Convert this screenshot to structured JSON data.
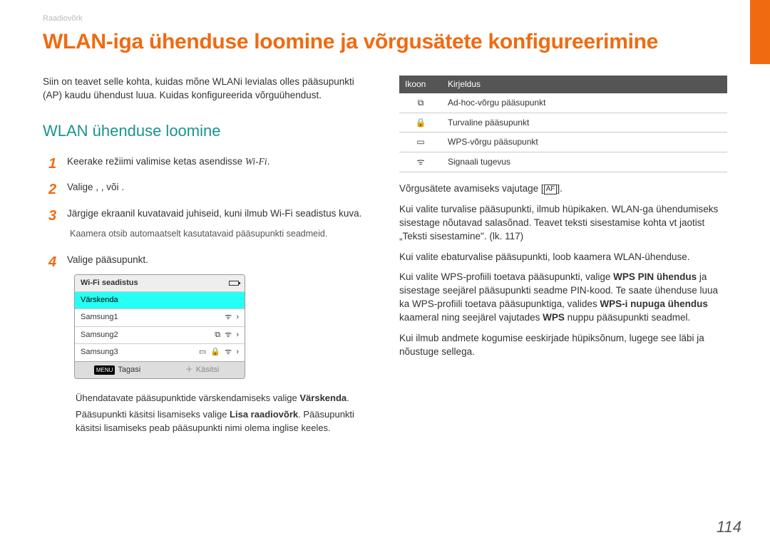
{
  "breadcrumb": "Raadiovõrk",
  "title": "WLAN-iga ühenduse loomine ja võrgusätete konfigureerimine",
  "intro": "Siin on teavet selle kohta, kuidas mõne WLANi levialas olles pääsupunkti (AP) kaudu ühendust luua. Kuidas konfigureerida võrguühendust.",
  "subheading": "WLAN ühenduse loomine",
  "steps": {
    "s1_a": "Keerake režiimi valimise ketas asendisse ",
    "s1_wifi": "Wi-Fi",
    "s1_b": ".",
    "s2_a": "Valige ",
    "s2_b": " , ",
    "s2_c": " , või ",
    "s2_d": " .",
    "s3": "Järgige ekraanil kuvatavaid juhiseid, kuni ilmub Wi-Fi seadistus kuva.",
    "s3_note": "Kaamera otsib automaatselt kasutatavaid pääsupunkti seadmeid.",
    "s4": "Valige pääsupunkt."
  },
  "screenshot": {
    "title": "Wi-Fi seadistus",
    "refresh": "Värskenda",
    "rows": [
      "Samsung1",
      "Samsung2",
      "Samsung3"
    ],
    "footer_back_badge": "MENU",
    "footer_back": "Tagasi",
    "footer_manual": "Käsitsi"
  },
  "extra": {
    "e1_a": "Ühendatavate pääsupunktide värskendamiseks valige ",
    "e1_b": "Värskenda",
    "e1_c": ".",
    "e2_a": "Pääsupunkti käsitsi lisamiseks valige ",
    "e2_b": "Lisa raadiovõrk",
    "e2_c": ". Pääsupunkti käsitsi lisamiseks peab pääsupunkti nimi olema inglise keeles."
  },
  "table": {
    "h1": "Ikoon",
    "h2": "Kirjeldus",
    "r1": "Ad-hoc-võrgu pääsupunkt",
    "r2": "Turvaline pääsupunkt",
    "r3": "WPS-võrgu pääsupunkt",
    "r4": "Signaali tugevus"
  },
  "right": {
    "p1_a": "Võrgusätete avamiseks vajutage [",
    "p1_af": "AF",
    "p1_b": "].",
    "p2": "Kui valite turvalise pääsupunkti, ilmub hüpikaken. WLAN-ga ühendumiseks sisestage nõutavad salasõnad. Teavet teksti sisestamise kohta vt jaotist „Teksti sisestamine\". (lk. 117)",
    "p3": "Kui valite ebaturvalise pääsupunkti, loob kaamera WLAN-ühenduse.",
    "p4_a": "Kui valite WPS-profiili toetava pääsupunkti, valige ",
    "p4_b": "WPS PIN ühendus",
    "p4_c": " ja sisestage seejärel pääsupunkti seadme PIN-kood. Te saate ühenduse luua ka WPS-profiili toetava pääsupunktiga, valides ",
    "p4_d": "WPS-i nupuga ühendus",
    "p4_e": " kaameral ning seejärel vajutades ",
    "p4_f": "WPS",
    "p4_g": " nuppu pääsupunkti seadmel.",
    "p5": "Kui ilmub andmete kogumise eeskirjade hüpiksõnum, lugege see läbi ja nõustuge sellega."
  },
  "page": "114"
}
